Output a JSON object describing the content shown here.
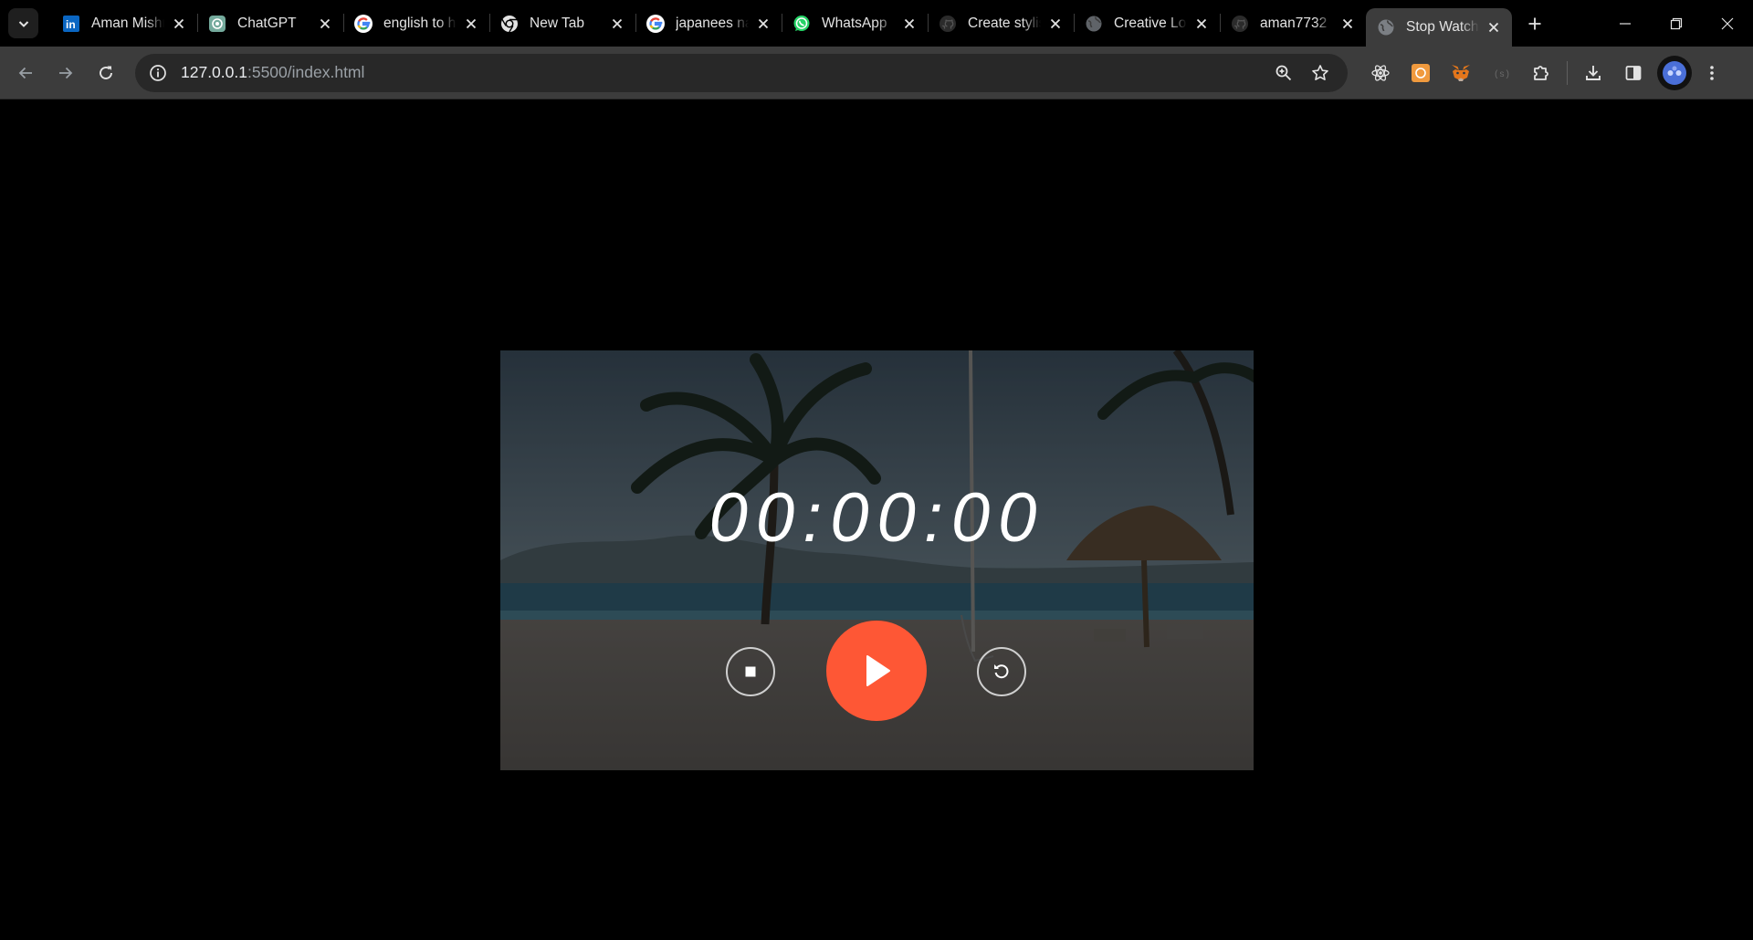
{
  "browser": {
    "tabs": [
      {
        "title": "Aman Mishra",
        "icon": "linkedin-icon"
      },
      {
        "title": "ChatGPT",
        "icon": "chatgpt-icon"
      },
      {
        "title": "english to hindi",
        "icon": "google-icon"
      },
      {
        "title": "New Tab",
        "icon": "chrome-icon"
      },
      {
        "title": "japanees name",
        "icon": "google-icon"
      },
      {
        "title": "WhatsApp",
        "icon": "whatsapp-icon"
      },
      {
        "title": "Create stylish",
        "icon": "github-icon"
      },
      {
        "title": "Creative Logo",
        "icon": "globe-icon"
      },
      {
        "title": "aman7732",
        "icon": "github-icon"
      },
      {
        "title": "Stop Watch",
        "icon": "globe-icon",
        "active": true
      }
    ],
    "url": {
      "host": "127.0.0.1",
      "path": ":5500/index.html"
    }
  },
  "stopwatch": {
    "time": "00:00:00",
    "buttons": {
      "stop": "stop-icon",
      "play": "play-icon",
      "reset": "reset-icon"
    },
    "accent_color": "#fe5735"
  },
  "colors": {
    "tabstrip": "#000000",
    "toolbar": "#3c3c3c",
    "omnibox": "#282828",
    "page_background": "#000000"
  }
}
